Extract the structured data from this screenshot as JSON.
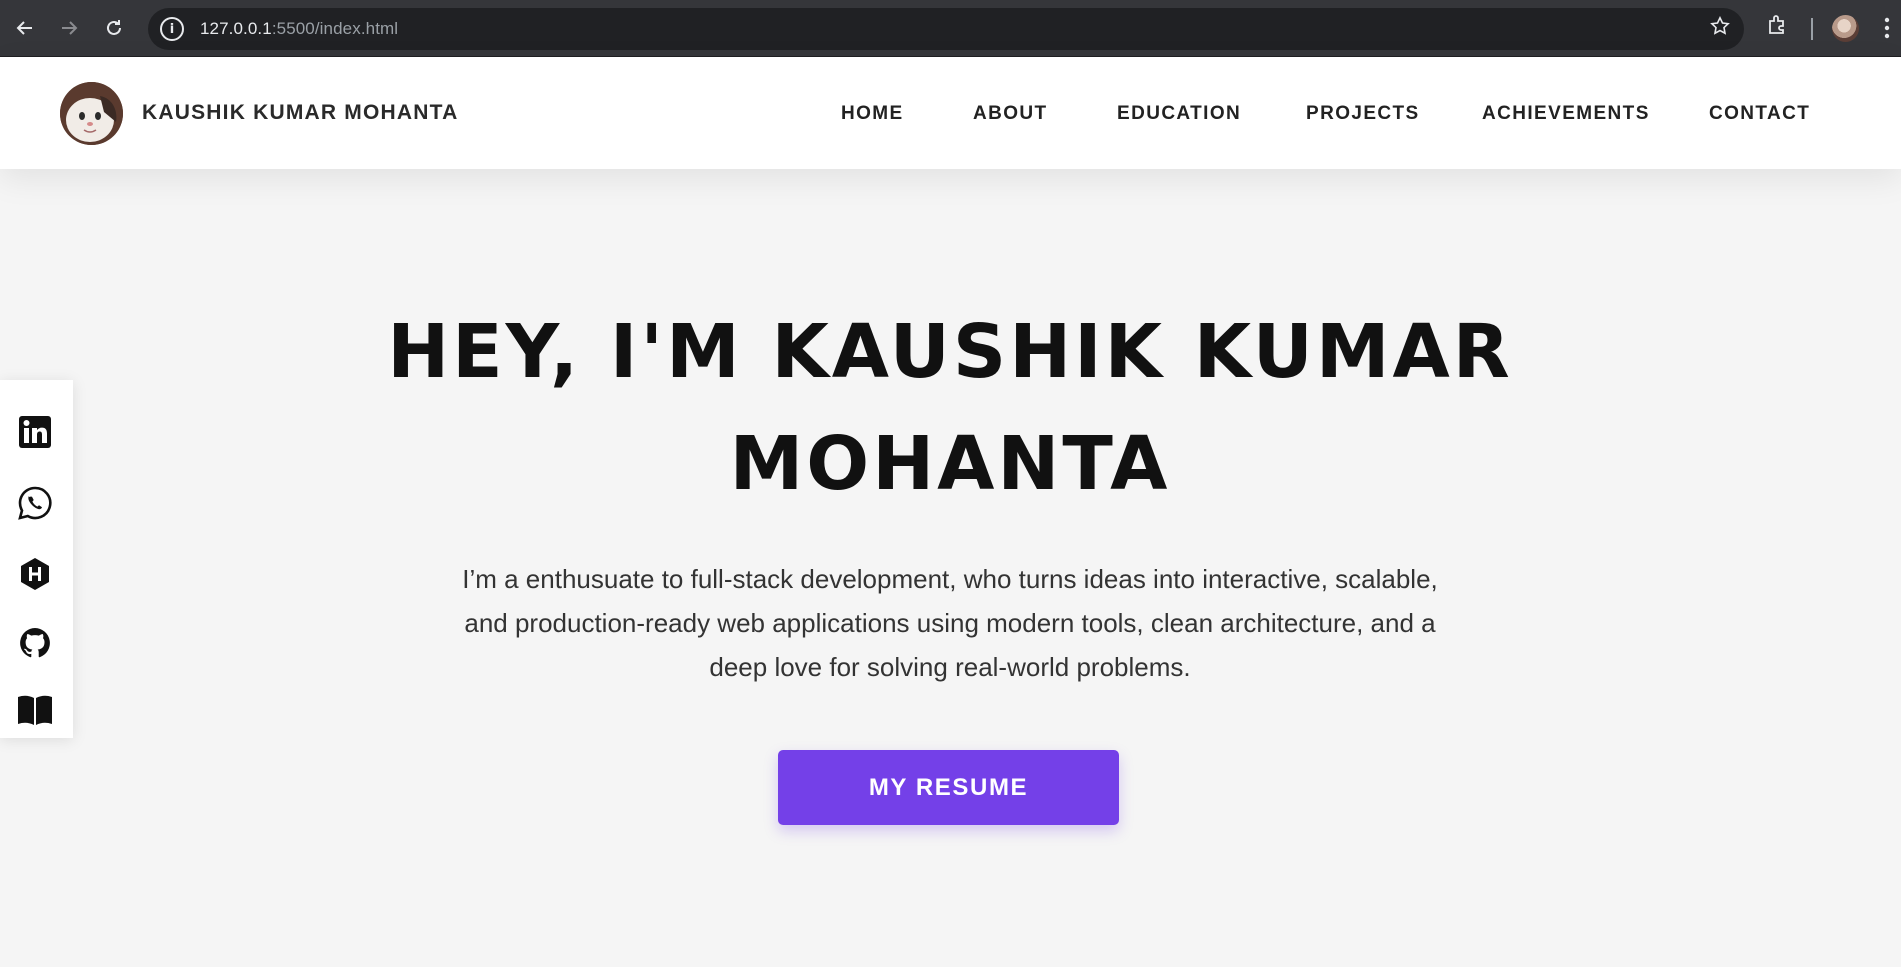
{
  "browser": {
    "url_host": "127.0.0.1",
    "url_path": ":5500/index.html"
  },
  "header": {
    "brand": "KAUSHIK KUMAR MOHANTA",
    "nav": [
      "HOME",
      "ABOUT",
      "EDUCATION",
      "PROJECTS",
      "ACHIEVEMENTS",
      "CONTACT"
    ]
  },
  "social": [
    "linkedin-icon",
    "whatsapp-icon",
    "hashnode-icon",
    "github-icon",
    "book-icon"
  ],
  "hero": {
    "title": "HEY, I'M KAUSHIK KUMAR MOHANTA",
    "description": "I’m a enthusuate to full-stack development, who turns ideas into interactive, scalable, and production-ready web applications using modern tools, clean architecture, and a deep love for solving real-world problems.",
    "button": "MY RESUME"
  },
  "colors": {
    "accent": "#7440e8",
    "background": "#f5f5f5"
  }
}
